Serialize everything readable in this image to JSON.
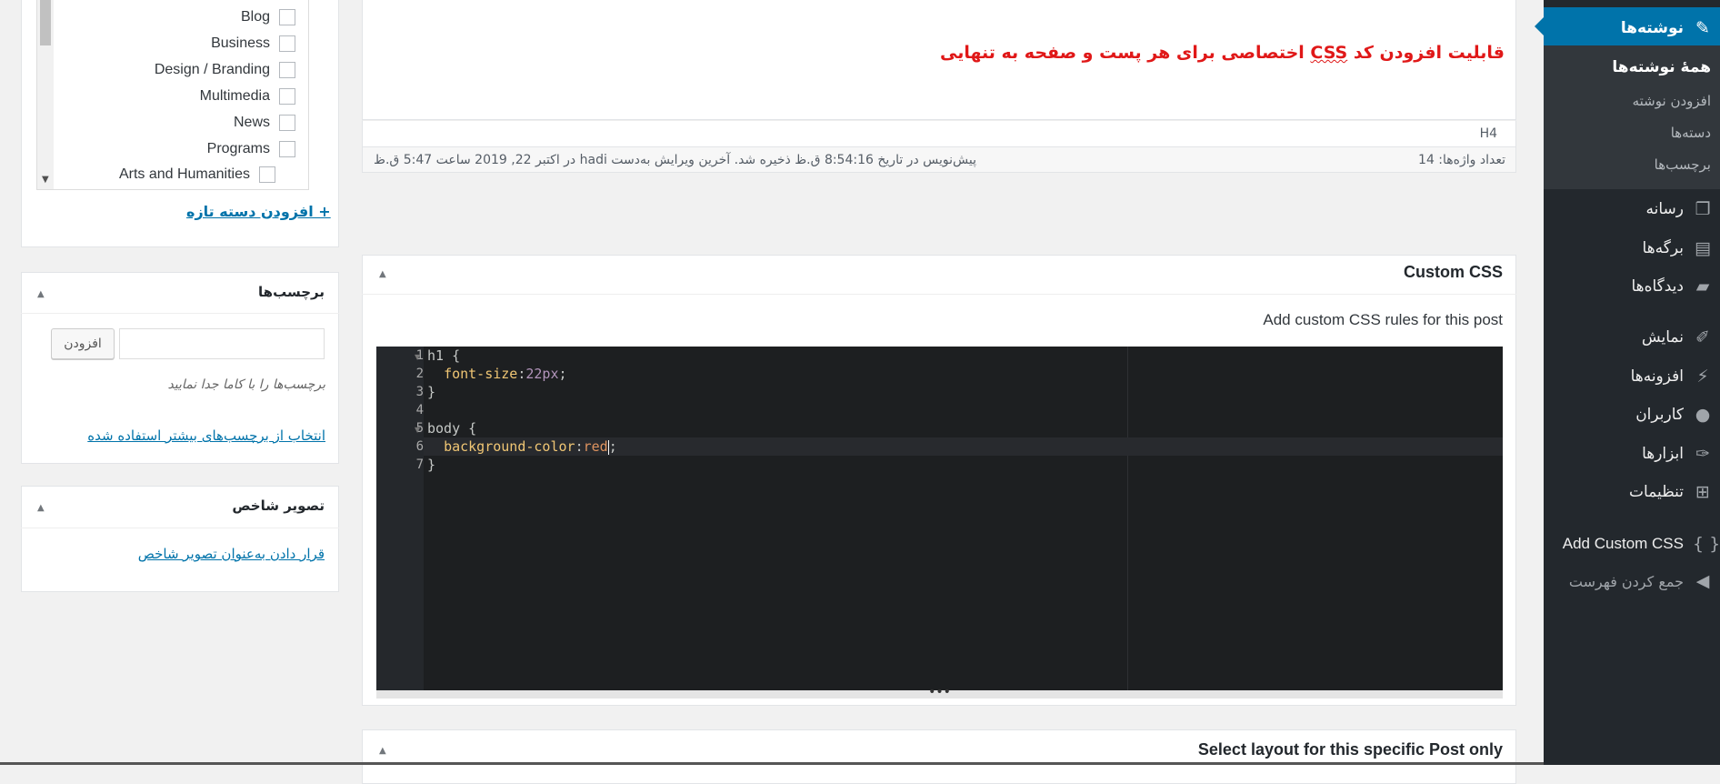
{
  "colors": {
    "sidebar_bg": "#23282d",
    "sidebar_active": "#0073aa",
    "title_red": "#e01818",
    "link": "#0073aa",
    "code_bg": "#1d1f21"
  },
  "categories": {
    "items": [
      "Blog",
      "Business",
      "Design / Branding",
      "Multimedia",
      "News",
      "Programs",
      "Arts and Humanities"
    ],
    "add_new_link": "+ افزودن دسته تازه"
  },
  "tags": {
    "title": "برچسب‌ها",
    "input_placeholder": "",
    "add_button": "افزودن",
    "hint": "برچسب‌ها را با کاما جدا نمایید",
    "choose_link": "انتخاب از برچسب‌های بیشتر استفاده شده"
  },
  "featured_image": {
    "title": "تصویر شاخص",
    "set_link": "قرار دادن به‌عنوان تصویر شاخص"
  },
  "editor": {
    "title_before": "قابلیت افزودن کد ",
    "title_css": "CSS",
    "title_after": " اختصاصی برای هر پست و صفحه به تنهایی",
    "path": "H4",
    "word_count": "تعداد واژه‌ها: 14",
    "last_saved": "پیش‌نویس در تاریخ 8:54:16 ق.ظ ذخیره شد. آخرین ویرایش به‌دست hadi در اکتبر 22, 2019 ساعت 5:47 ق.ظ"
  },
  "custom_css": {
    "title": "Custom CSS",
    "description": "Add custom CSS rules for this post",
    "line_numbers": [
      "1",
      "2",
      "3",
      "4",
      "5",
      "6",
      "7"
    ],
    "code": {
      "l1": "h1 {",
      "l2_prop": "font-size",
      "l2_val": "22px",
      "l3": "}",
      "l5": "body {",
      "l6_prop": "background-color",
      "l6_val": "red",
      "l7": "}"
    }
  },
  "layout_box": {
    "title": "Select layout for this specific Post only"
  },
  "sidebar": {
    "current": "نوشته‌ها",
    "submenu": [
      "همهٔ نوشته‌ها",
      "افزودن نوشته",
      "دسته‌ها",
      "برچسب‌ها"
    ],
    "items": [
      "رسانه",
      "برگه‌ها",
      "دیدگاه‌ها",
      "نمایش",
      "افزونه‌ها",
      "کاربران",
      "ابزارها",
      "تنظیمات"
    ],
    "add_custom_css": "Add Custom CSS",
    "collapse": "جمع کردن فهرست"
  }
}
